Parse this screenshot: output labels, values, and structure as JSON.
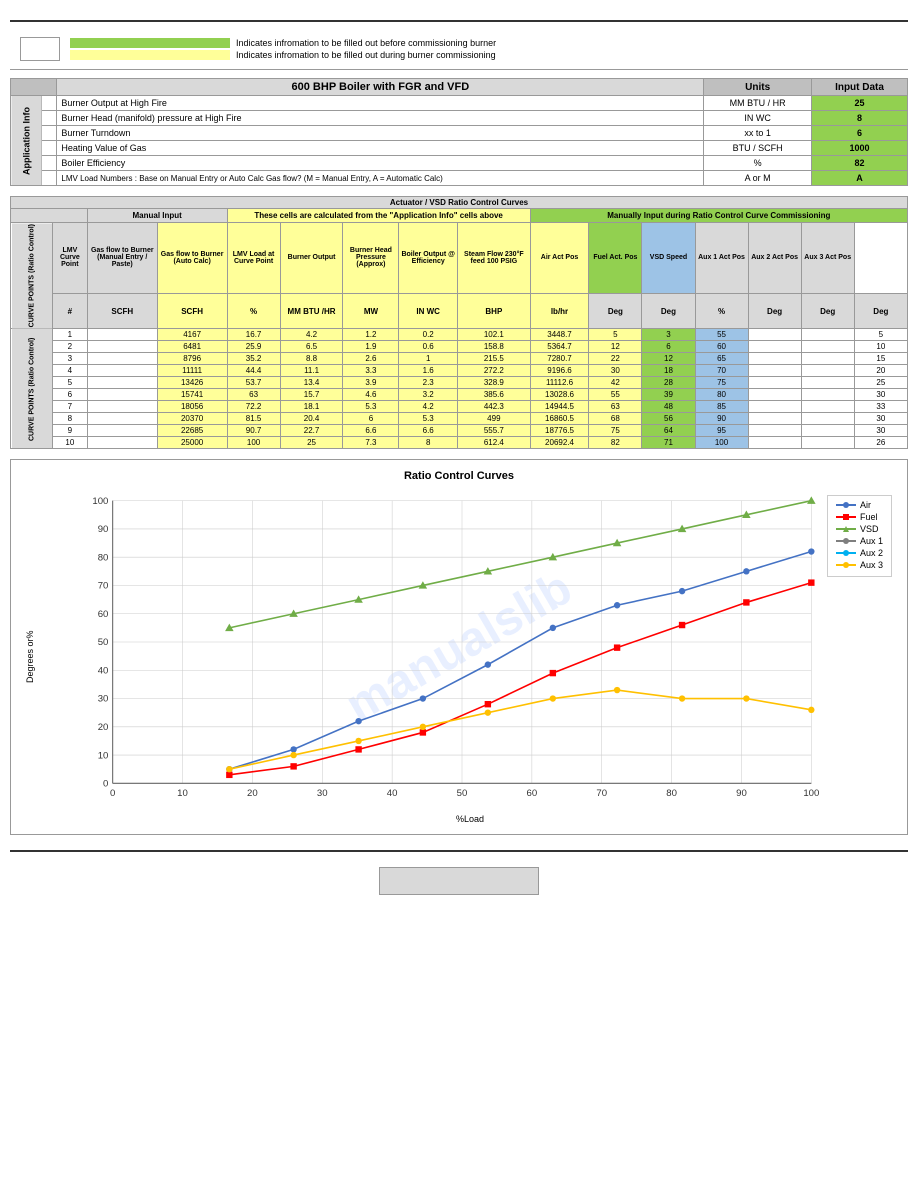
{
  "topBar": true,
  "legend": {
    "items": [
      {
        "color": "green",
        "text": "Indicates infromation to be filled out before commissioning burner"
      },
      {
        "color": "yellow",
        "text": "Indicates infromation to be filled out during burner commissioning"
      }
    ]
  },
  "appInfo": {
    "title": "600 BHP Boiler with FGR and VFD",
    "units_header": "Units",
    "input_data_header": "Input Data",
    "section_label": "Application Info",
    "rows": [
      {
        "label": "Burner Output at High Fire",
        "units": "MM BTU / HR",
        "value": "25"
      },
      {
        "label": "Burner Head (manifold) pressure at High Fire",
        "units": "IN WC",
        "value": "8"
      },
      {
        "label": "Burner Turndown",
        "units": "xx to 1",
        "value": "6"
      },
      {
        "label": "Heating Value of Gas",
        "units": "BTU / SCFH",
        "value": "1000"
      },
      {
        "label": "Boiler Efficiency",
        "units": "%",
        "value": "82"
      },
      {
        "label": "LMV Load Numbers : Base on Manual Entry or Auto Calc Gas flow? (M = Manual Entry, A = Automatic Calc)",
        "units": "A or M",
        "value": "A"
      }
    ]
  },
  "ratioControl": {
    "title": "Actuator / VSD Ratio Control Curves",
    "headers": {
      "manual_input": "Manual Input",
      "auto_calc": "These cells are calculated from the \"Application Info\" cells above",
      "manual_commission": "Manually Input during Ratio Control Curve Commissioning"
    },
    "col_headers": [
      "LMV Curve Point",
      "Gas flow to Burner (Manual Entry / Paste)",
      "Gas flow to Burner (Auto Calc)",
      "LMV Load at Curve Point",
      "Burner Output",
      "Burner Head Pressure (Approx)",
      "Boiler Output @ Efficiency",
      "Steam Flow 230°F feed 100 PSIG",
      "Air Act Pos",
      "Fuel Act. Pos",
      "VSD Speed",
      "Aux 1 Act Pos",
      "Aux 2 Act Pos",
      "Aux 3 Act Pos"
    ],
    "units_row": [
      "#",
      "SCFH",
      "SCFH",
      "%",
      "MM BTU /HR",
      "MW",
      "IN WC",
      "BHP",
      "lb/hr",
      "Deg",
      "Deg",
      "%",
      "Deg",
      "Deg",
      "Deg"
    ],
    "section_label": "CURVE POINTS (Ratio Control)",
    "data_rows": [
      {
        "point": 1,
        "curve": 1,
        "gas_manual": "",
        "gas_auto": 4167,
        "lmv_load": 16.7,
        "burner_out": 4.2,
        "burner_mw": 1.2,
        "head_pres": 0.2,
        "boiler_bhp": 102.1,
        "steam_flow": 3448.7,
        "air_act": 5.0,
        "fuel_act": 3.0,
        "vsd": 55.0,
        "aux1": "",
        "aux2": "",
        "aux3": 5.0
      },
      {
        "point": 2,
        "curve": 2,
        "gas_manual": "",
        "gas_auto": 6481,
        "lmv_load": 25.9,
        "burner_out": 6.5,
        "burner_mw": 1.9,
        "head_pres": 0.6,
        "boiler_bhp": 158.8,
        "steam_flow": 5364.7,
        "air_act": 12.0,
        "fuel_act": 6.0,
        "vsd": 60.0,
        "aux1": "",
        "aux2": "",
        "aux3": 10.0
      },
      {
        "point": 3,
        "curve": 3,
        "gas_manual": "",
        "gas_auto": 8796,
        "lmv_load": 35.2,
        "burner_out": 8.8,
        "burner_mw": 2.6,
        "head_pres": 1.0,
        "boiler_bhp": 215.5,
        "steam_flow": 7280.7,
        "air_act": 22.0,
        "fuel_act": 12.0,
        "vsd": 65.0,
        "aux1": "",
        "aux2": "",
        "aux3": 15.0
      },
      {
        "point": 4,
        "curve": 4,
        "gas_manual": "",
        "gas_auto": 11111,
        "lmv_load": 44.4,
        "burner_out": 11.1,
        "burner_mw": 3.3,
        "head_pres": 1.6,
        "boiler_bhp": 272.2,
        "steam_flow": 9196.6,
        "air_act": 30.0,
        "fuel_act": 18.0,
        "vsd": 70.0,
        "aux1": "",
        "aux2": "",
        "aux3": 20.0
      },
      {
        "point": 5,
        "curve": 5,
        "gas_manual": "",
        "gas_auto": 13426,
        "lmv_load": 53.7,
        "burner_out": 13.4,
        "burner_mw": 3.9,
        "head_pres": 2.3,
        "boiler_bhp": 328.9,
        "steam_flow": 11112.6,
        "air_act": 42.0,
        "fuel_act": 28.0,
        "vsd": 75.0,
        "aux1": "",
        "aux2": "",
        "aux3": 25.0
      },
      {
        "point": 6,
        "curve": 6,
        "gas_manual": "",
        "gas_auto": 15741,
        "lmv_load": 63.0,
        "burner_out": 15.7,
        "burner_mw": 4.6,
        "head_pres": 3.2,
        "boiler_bhp": 385.6,
        "steam_flow": 13028.6,
        "air_act": 55.0,
        "fuel_act": 39.0,
        "vsd": 80.0,
        "aux1": "",
        "aux2": "",
        "aux3": 30.0
      },
      {
        "point": 7,
        "curve": 7,
        "gas_manual": "",
        "gas_auto": 18056,
        "lmv_load": 72.2,
        "burner_out": 18.1,
        "burner_mw": 5.3,
        "head_pres": 4.2,
        "boiler_bhp": 442.3,
        "steam_flow": 14944.5,
        "air_act": 63.0,
        "fuel_act": 48.0,
        "vsd": 85.0,
        "aux1": "",
        "aux2": "",
        "aux3": 33.0
      },
      {
        "point": 8,
        "curve": 8,
        "gas_manual": "",
        "gas_auto": 20370,
        "lmv_load": 81.5,
        "burner_out": 20.4,
        "burner_mw": 6.0,
        "head_pres": 5.3,
        "boiler_bhp": 499.0,
        "steam_flow": 16860.5,
        "air_act": 68.0,
        "fuel_act": 56.0,
        "vsd": 90.0,
        "aux1": "",
        "aux2": "",
        "aux3": 30.0
      },
      {
        "point": 9,
        "curve": 9,
        "gas_manual": "",
        "gas_auto": 22685,
        "lmv_load": 90.7,
        "burner_out": 22.7,
        "burner_mw": 6.6,
        "head_pres": 6.6,
        "boiler_bhp": 555.7,
        "steam_flow": 18776.5,
        "air_act": 75.0,
        "fuel_act": 64.0,
        "vsd": 95.0,
        "aux1": "",
        "aux2": "",
        "aux3": 30.0
      },
      {
        "point": 10,
        "curve": 10,
        "gas_manual": "",
        "gas_auto": 25000,
        "lmv_load": 100.0,
        "burner_out": 25.0,
        "burner_mw": 7.3,
        "head_pres": 8.0,
        "boiler_bhp": 612.4,
        "steam_flow": 20692.4,
        "air_act": 82.0,
        "fuel_act": 71.0,
        "vsd": 100.0,
        "aux1": "",
        "aux2": "",
        "aux3": 26.0
      }
    ]
  },
  "chart": {
    "title": "Ratio Control Curves",
    "y_label": "Degrees or%",
    "x_label": "%Load",
    "legend": [
      {
        "label": "Air",
        "color": "#4472C4"
      },
      {
        "label": "Fuel",
        "color": "#FF0000"
      },
      {
        "label": "VSD",
        "color": "#70AD47"
      },
      {
        "label": "Aux 1",
        "color": "#7F7F7F"
      },
      {
        "label": "Aux 2",
        "color": "#00B0F0"
      },
      {
        "label": "Aux 3",
        "color": "#FFC000"
      }
    ],
    "series": {
      "air": {
        "color": "#4472C4",
        "points": [
          [
            16.7,
            5
          ],
          [
            25.9,
            12
          ],
          [
            35.2,
            22
          ],
          [
            44.4,
            30
          ],
          [
            53.7,
            42
          ],
          [
            63,
            55
          ],
          [
            72.2,
            63
          ],
          [
            81.5,
            68
          ],
          [
            90.7,
            75
          ],
          [
            100,
            82
          ]
        ]
      },
      "fuel": {
        "color": "#FF0000",
        "points": [
          [
            16.7,
            3
          ],
          [
            25.9,
            6
          ],
          [
            35.2,
            12
          ],
          [
            44.4,
            18
          ],
          [
            53.7,
            28
          ],
          [
            63,
            39
          ],
          [
            72.2,
            48
          ],
          [
            81.5,
            56
          ],
          [
            90.7,
            64
          ],
          [
            100,
            71
          ]
        ]
      },
      "vsd": {
        "color": "#70AD47",
        "points": [
          [
            16.7,
            55
          ],
          [
            25.9,
            60
          ],
          [
            35.2,
            65
          ],
          [
            44.4,
            70
          ],
          [
            53.7,
            75
          ],
          [
            63,
            80
          ],
          [
            72.2,
            85
          ],
          [
            81.5,
            90
          ],
          [
            90.7,
            95
          ],
          [
            100,
            100
          ]
        ]
      },
      "aux1": {
        "color": "#7F7F7F",
        "points": []
      },
      "aux2": {
        "color": "#00B0F0",
        "points": []
      },
      "aux3": {
        "color": "#FFC000",
        "points": [
          [
            16.7,
            5
          ],
          [
            25.9,
            10
          ],
          [
            35.2,
            15
          ],
          [
            44.4,
            20
          ],
          [
            53.7,
            25
          ],
          [
            63,
            30
          ],
          [
            72.2,
            33
          ],
          [
            81.5,
            30
          ],
          [
            90.7,
            30
          ],
          [
            100,
            26
          ]
        ]
      }
    }
  },
  "watermark": "manualslib",
  "bottom_button": ""
}
